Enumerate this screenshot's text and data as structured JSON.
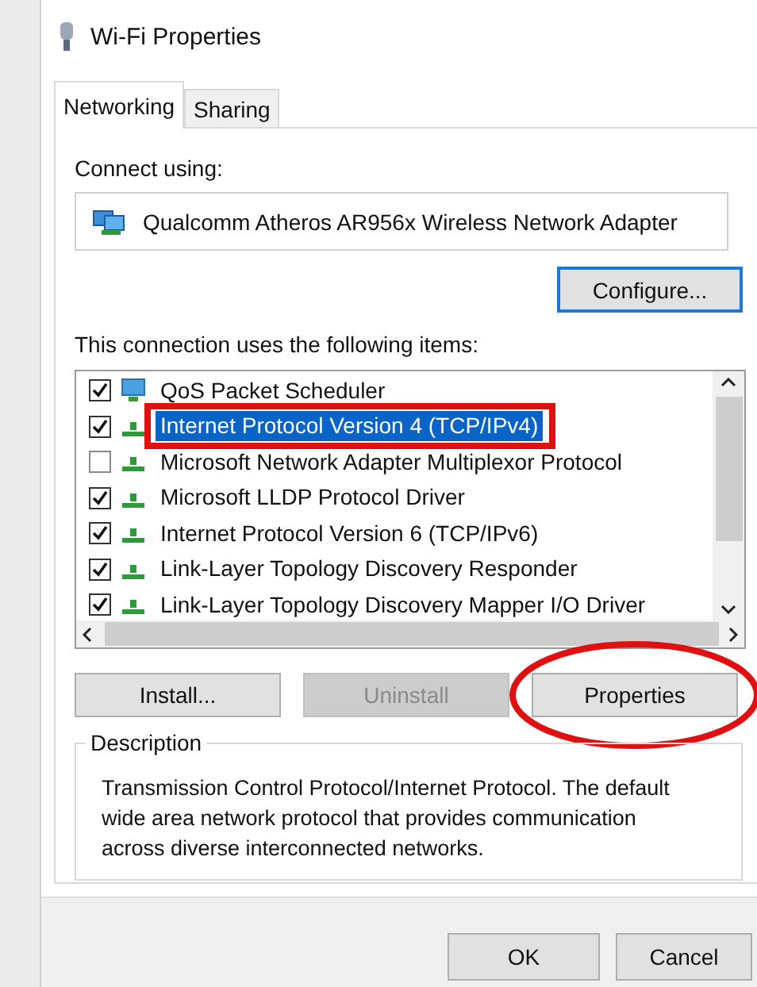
{
  "window": {
    "title": "Wi-Fi Properties"
  },
  "tabs": [
    {
      "label": "Networking",
      "selected": true
    },
    {
      "label": "Sharing",
      "selected": false
    }
  ],
  "connect_using": {
    "label": "Connect using:",
    "adapter": "Qualcomm Atheros AR956x Wireless Network Adapter",
    "button": {
      "label": "Configure...",
      "focused": true
    }
  },
  "items_label": "This connection uses the following items:",
  "items": [
    {
      "kind": "service",
      "label": "QoS Packet Scheduler",
      "checked": true,
      "selected": false,
      "highlighted": false
    },
    {
      "kind": "protocol",
      "label": "Internet Protocol Version 4 (TCP/IPv4)",
      "checked": true,
      "selected": true,
      "highlighted": true
    },
    {
      "kind": "protocol",
      "label": "Microsoft Network Adapter Multiplexor Protocol",
      "checked": false,
      "selected": false,
      "highlighted": false
    },
    {
      "kind": "protocol",
      "label": "Microsoft LLDP Protocol Driver",
      "checked": true,
      "selected": false,
      "highlighted": false
    },
    {
      "kind": "protocol",
      "label": "Internet Protocol Version 6 (TCP/IPv6)",
      "checked": true,
      "selected": false,
      "highlighted": false
    },
    {
      "kind": "protocol",
      "label": "Link-Layer Topology Discovery Responder",
      "checked": true,
      "selected": false,
      "highlighted": false
    },
    {
      "kind": "protocol",
      "label": "Link-Layer Topology Discovery Mapper I/O Driver",
      "checked": true,
      "selected": false,
      "highlighted": false
    }
  ],
  "buttons": [
    {
      "label": "Install...",
      "disabled": false,
      "highlighted": false
    },
    {
      "label": "Uninstall",
      "disabled": true,
      "highlighted": false
    },
    {
      "label": "Properties",
      "disabled": false,
      "highlighted": true
    }
  ],
  "description": {
    "title": "Description",
    "text": "Transmission Control Protocol/Internet Protocol. The default wide area network protocol that provides communication across diverse interconnected networks."
  },
  "footer_buttons": [
    {
      "label": "OK"
    },
    {
      "label": "Cancel"
    }
  ]
}
